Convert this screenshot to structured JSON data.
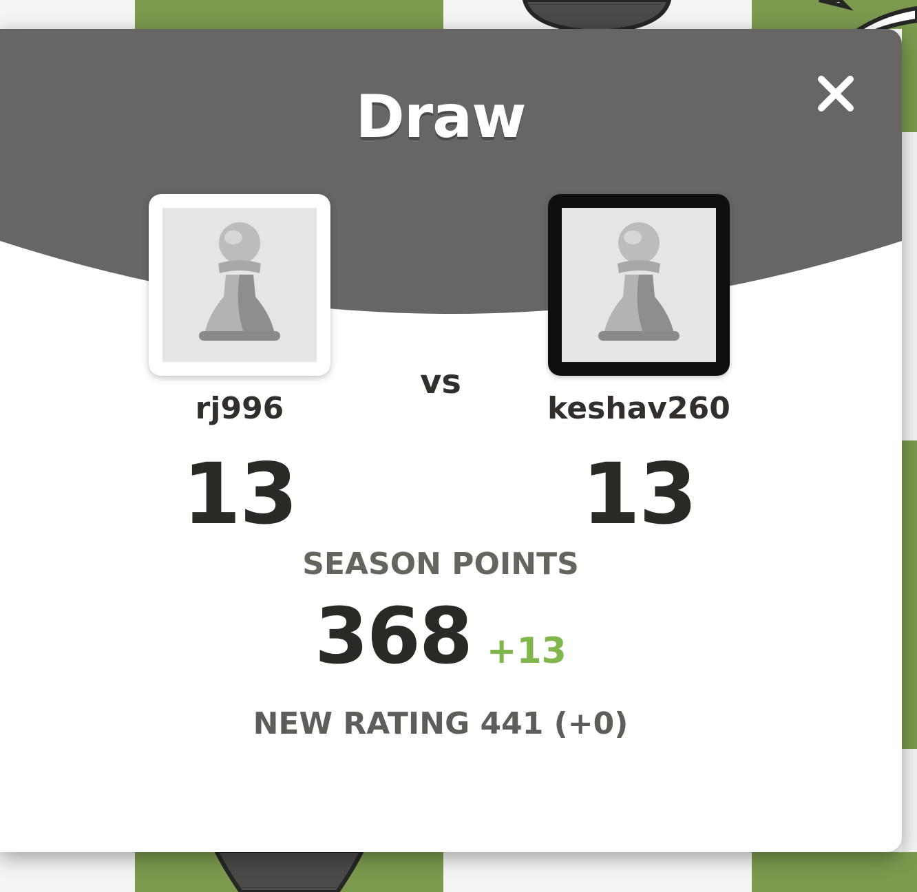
{
  "modal": {
    "title": "Draw",
    "close_icon": "close-icon"
  },
  "players": {
    "left": {
      "name": "rj996",
      "score": "13",
      "avatar_icon": "pawn-avatar-icon"
    },
    "right": {
      "name": "keshav260",
      "score": "13",
      "avatar_icon": "pawn-avatar-icon"
    },
    "versus_label": "vs"
  },
  "season": {
    "label": "SEASON POINTS",
    "points": "368",
    "delta": "+13"
  },
  "rating": {
    "text": "NEW RATING 441 (+0)"
  },
  "colors": {
    "header": "#676664",
    "board_green": "#7b9a4e",
    "board_light": "#f4f4f2",
    "delta_green": "#81b64c",
    "text_dark": "#312e2b"
  }
}
